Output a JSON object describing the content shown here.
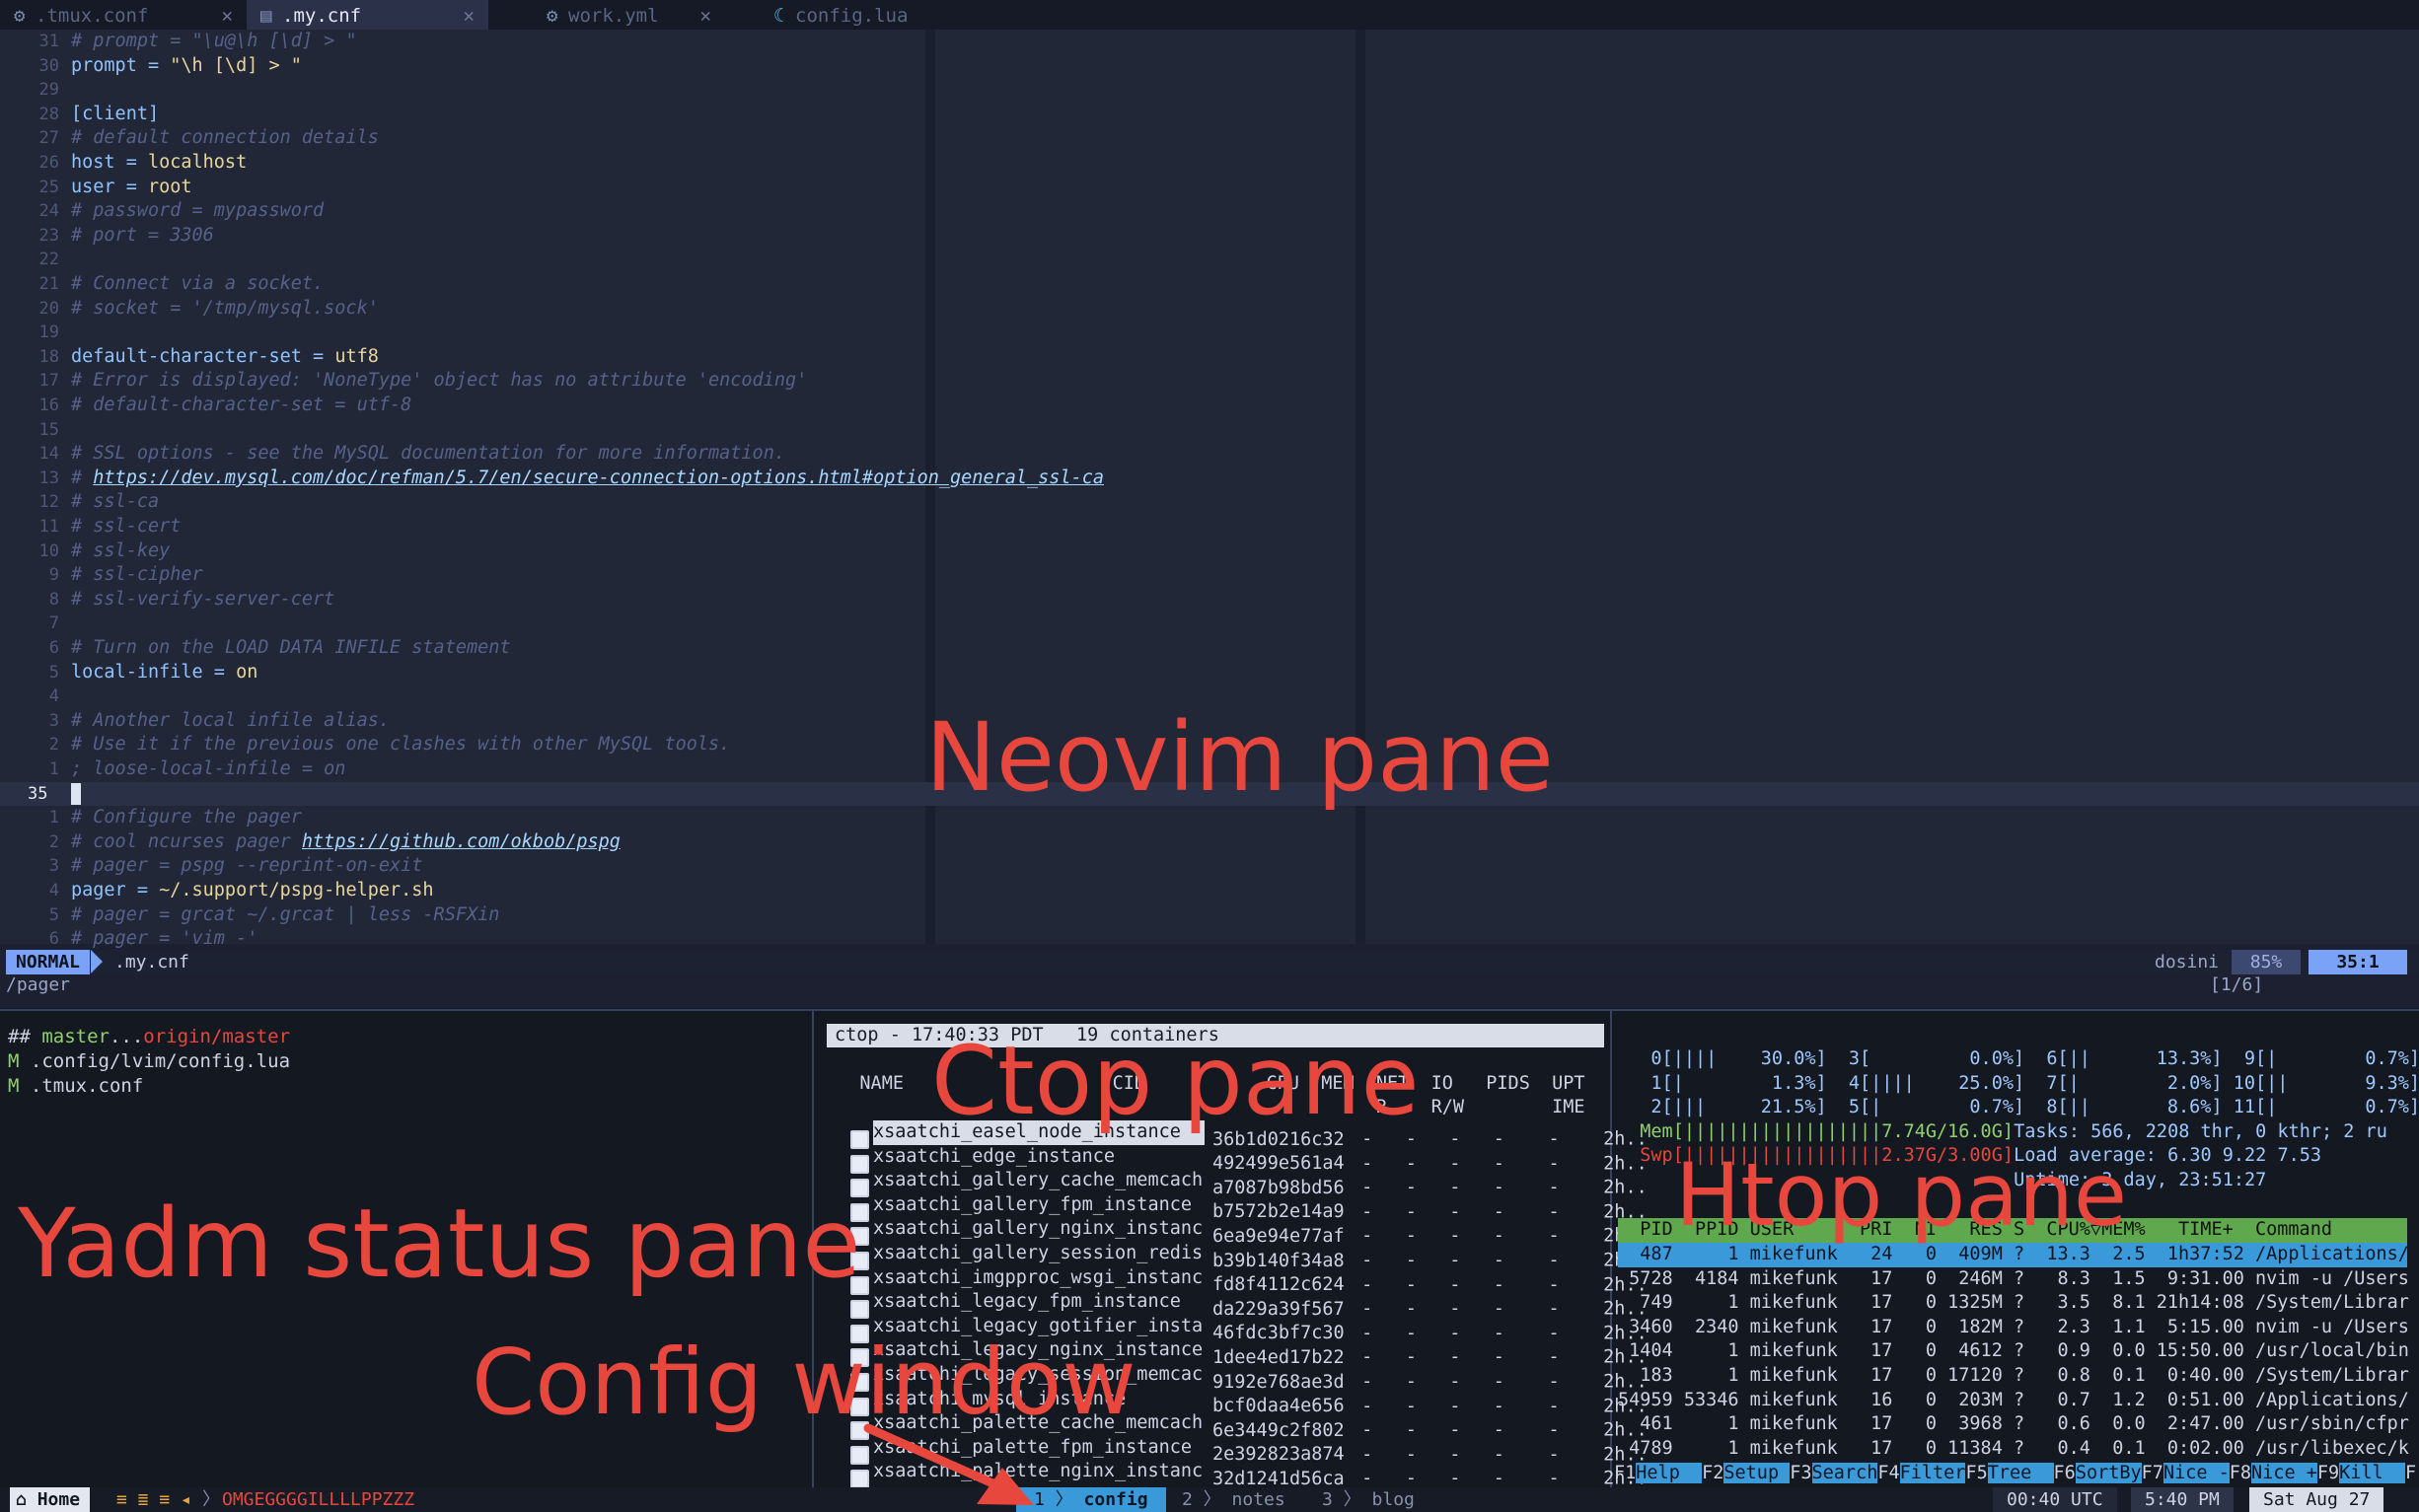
{
  "tabs": [
    {
      "label": ".tmux.conf",
      "icon": "gear"
    },
    {
      "label": ".my.cnf",
      "icon": "file"
    },
    {
      "label": "work.yml",
      "icon": "gear"
    },
    {
      "label": "config.lua",
      "icon": "lua"
    }
  ],
  "editor": {
    "lines": [
      {
        "n": "31",
        "t": "# prompt = \"\\u@\\h [\\d] > \"",
        "k": "cmt"
      },
      {
        "n": "30",
        "t": "prompt = \"\\h [\\d] > \"",
        "k": "kv"
      },
      {
        "n": "29",
        "t": "",
        "k": "plain"
      },
      {
        "n": "28",
        "t": "[client]",
        "k": "sect"
      },
      {
        "n": "27",
        "t": "# default connection details",
        "k": "cmt"
      },
      {
        "n": "26",
        "t": "host = localhost",
        "k": "kv"
      },
      {
        "n": "25",
        "t": "user = root",
        "k": "kv"
      },
      {
        "n": "24",
        "t": "# password = mypassword",
        "k": "cmt"
      },
      {
        "n": "23",
        "t": "# port = 3306",
        "k": "cmt"
      },
      {
        "n": "22",
        "t": "",
        "k": "plain"
      },
      {
        "n": "21",
        "t": "# Connect via a socket.",
        "k": "cmt"
      },
      {
        "n": "20",
        "t": "# socket = '/tmp/mysql.sock'",
        "k": "cmt"
      },
      {
        "n": "19",
        "t": "",
        "k": "plain"
      },
      {
        "n": "18",
        "t": "default-character-set = utf8",
        "k": "kv"
      },
      {
        "n": "17",
        "t": "# Error is displayed: 'NoneType' object has no attribute 'encoding'",
        "k": "cmt"
      },
      {
        "n": "16",
        "t": "# default-character-set = utf-8",
        "k": "cmt"
      },
      {
        "n": "15",
        "t": "",
        "k": "plain"
      },
      {
        "n": "14",
        "t": "# SSL options - see the MySQL documentation for more information.",
        "k": "cmt"
      },
      {
        "n": "13",
        "t": "# ",
        "k": "cmt",
        "url": "https://dev.mysql.com/doc/refman/5.7/en/secure-connection-options.html#option_general_ssl-ca"
      },
      {
        "n": "12",
        "t": "# ssl-ca",
        "k": "cmt"
      },
      {
        "n": "11",
        "t": "# ssl-cert",
        "k": "cmt"
      },
      {
        "n": "10",
        "t": "# ssl-key",
        "k": "cmt"
      },
      {
        "n": "9",
        "t": "# ssl-cipher",
        "k": "cmt"
      },
      {
        "n": "8",
        "t": "# ssl-verify-server-cert",
        "k": "cmt"
      },
      {
        "n": "7",
        "t": "",
        "k": "plain"
      },
      {
        "n": "6",
        "t": "# Turn on the LOAD DATA INFILE statement",
        "k": "cmt"
      },
      {
        "n": "5",
        "t": "local-infile = on",
        "k": "kv"
      },
      {
        "n": "4",
        "t": "",
        "k": "plain"
      },
      {
        "n": "3",
        "t": "# Another local infile alias.",
        "k": "cmt"
      },
      {
        "n": "2",
        "t": "# Use it if the previous one clashes with other MySQL tools.",
        "k": "cmt"
      },
      {
        "n": "1",
        "t": "; loose-local-infile = on",
        "k": "cmt"
      },
      {
        "n": "35",
        "t": "",
        "k": "cursor"
      },
      {
        "n": "1",
        "t": "# Configure the pager",
        "k": "cmt"
      },
      {
        "n": "2",
        "t": "# cool ncurses pager ",
        "k": "cmt",
        "url": "https://github.com/okbob/pspg"
      },
      {
        "n": "3",
        "t": "# pager = pspg --reprint-on-exit",
        "k": "cmt"
      },
      {
        "n": "4",
        "t": "pager = ~/.support/pspg-helper.sh",
        "k": "kv"
      },
      {
        "n": "5",
        "t": "# pager = grcat ~/.grcat | less -RSFXin",
        "k": "cmt"
      },
      {
        "n": "6",
        "t": "# pager = 'vim -'",
        "k": "cmt"
      }
    ]
  },
  "statusline": {
    "mode": "NORMAL",
    "filename": ".my.cnf",
    "filetype": "dosini",
    "percent": "85%",
    "position": "35:1"
  },
  "cmdline": {
    "text": "/pager",
    "count": "[1/6]"
  },
  "yadm": {
    "branch_prefix": "## ",
    "branch": "master",
    "sep": "...",
    "remote": "origin/master",
    "files": [
      {
        "status": "M",
        "path": ".config/lvim/config.lua"
      },
      {
        "status": "M",
        "path": ".tmux.conf"
      }
    ]
  },
  "ctop": {
    "header": "ctop - 17:40:33 PDT   19 containers",
    "cols1": "   NAME                   CID           CPU  MEM  NET  IO   PIDS  UPT",
    "cols2": "                                                  R..  R/W        IME",
    "rows": [
      {
        "name": "xsaatchi_easel_node_instance",
        "cid": "36b1d0216c32",
        "stats": " -   -   -   -    -    2h.."
      },
      {
        "name": "xsaatchi_edge_instance",
        "cid": "492499e561a4",
        "stats": " -   -   -   -    -    2h.."
      },
      {
        "name": "xsaatchi_gallery_cache_memcach",
        "cid": "a7087b98bd56",
        "stats": " -   -   -   -    -    2h.."
      },
      {
        "name": "xsaatchi_gallery_fpm_instance",
        "cid": "b7572b2e14a9",
        "stats": " -   -   -   -    -    2h.."
      },
      {
        "name": "xsaatchi_gallery_nginx_instanc",
        "cid": "6ea9e94e77af",
        "stats": " -   -   -   -    -    2h.."
      },
      {
        "name": "xsaatchi_gallery_session_redis",
        "cid": "b39b140f34a8",
        "stats": " -   -   -   -    -    2h.."
      },
      {
        "name": "xsaatchi_imgpproc_wsgi_instanc",
        "cid": "fd8f4112c624",
        "stats": " -   -   -   -    -    2h.."
      },
      {
        "name": "xsaatchi_legacy_fpm_instance",
        "cid": "da229a39f567",
        "stats": " -   -   -   -    -    2h.."
      },
      {
        "name": "xsaatchi_legacy_gotifier_insta",
        "cid": "46fdc3bf7c30",
        "stats": " -   -   -   -    -    2h.."
      },
      {
        "name": "xsaatchi_legacy_nginx_instance",
        "cid": "1dee4ed17b22",
        "stats": " -   -   -   -    -    2h.."
      },
      {
        "name": "xsaatchi_legacy_session_memcac",
        "cid": "9192e768ae3d",
        "stats": " -   -   -   -    -    2h.."
      },
      {
        "name": "xsaatchi_mysql_instance",
        "cid": "bcf0daa4e656",
        "stats": " -   -   -   -    -    2h.."
      },
      {
        "name": "xsaatchi_palette_cache_memcach",
        "cid": "6e3449c2f802",
        "stats": " -   -   -   -    -    2h.."
      },
      {
        "name": "xsaatchi_palette_fpm_instance",
        "cid": "2e392823a874",
        "stats": " -   -   -   -    -    2h.."
      },
      {
        "name": "xsaatchi_palette_nginx_instanc",
        "cid": "32d1241d56ca",
        "stats": " -   -   -   -    -    2h.."
      }
    ]
  },
  "htop": {
    "cpu_rows": [
      "   0[||||    30.0%]  3[         0.0%]  6[||      13.3%]  9[|        0.7%]",
      "   1[|        1.3%]  4[||||    25.0%]  7[|        2.0%] 10[||       9.3%]",
      "   2[|||     21.5%]  5[|        0.7%]  8[||       8.6%] 11[|        0.7%]"
    ],
    "mem": "  Mem[||||||||||||||||||7.74G/16.0G]",
    "swp": "  Swp[||||||||||||||||||2.37G/3.00G]",
    "tasks": " Tasks: 566, 2208 thr, 0 kthr; 2 ru",
    "load": " Load average: 6.30 9.22 7.53",
    "uptime": " Uptime: 3 day, 23:51:27",
    "header": "  PID  PPID USER      PRI  NI   RES S  CPU%▽MEM%   TIME+  Command",
    "procs": [
      "  487     1 mikefunk   24   0  409M ?  13.3  2.5  1h37:52 /Applications/",
      " 5728  4184 mikefunk   17   0  246M ?   8.3  1.5  9:31.00 nvim -u /Users",
      "  749     1 mikefunk   17   0 1325M ?   3.5  8.1 21h14:08 /System/Librar",
      " 3460  2340 mikefunk   17   0  182M ?   2.3  1.1  5:15.00 nvim -u /Users",
      " 1404     1 mikefunk   17   0  4612 ?   0.9  0.0 15:50.00 /usr/local/bin",
      "  183     1 mikefunk   17   0 17120 ?   0.8  0.1  0:40.00 /System/Librar",
      "54959 53346 mikefunk   16   0  203M ?   0.7  1.2  0:51.00 /Applications/",
      "  461     1 mikefunk   17   0  3968 ?   0.6  0.0  2:47.00 /usr/sbin/cfpr",
      " 4789     1 mikefunk   17   0 11384 ?   0.4  0.1  0:02.00 /usr/libexec/k"
    ],
    "fkeys": [
      {
        "k": "F1",
        "l": "Help  "
      },
      {
        "k": "F2",
        "l": "Setup "
      },
      {
        "k": "F3",
        "l": "Search"
      },
      {
        "k": "F4",
        "l": "Filter"
      },
      {
        "k": "F5",
        "l": "Tree  "
      },
      {
        "k": "F6",
        "l": "SortBy"
      },
      {
        "k": "F7",
        "l": "Nice -"
      },
      {
        "k": "F8",
        "l": "Nice +"
      },
      {
        "k": "F9",
        "l": "Kill  "
      },
      {
        "k": "F",
        "l": ""
      }
    ]
  },
  "tmux": {
    "session": "Home",
    "git_info": "≡ ≣ ≡ ◂",
    "ticker": "OMGEGGGGILLLLPPZZZ",
    "windows": [
      {
        "num": "1",
        "name": "config",
        "active": true
      },
      {
        "num": "2",
        "name": "notes",
        "active": false
      },
      {
        "num": "3",
        "name": "blog",
        "active": false
      }
    ],
    "time_utc": "00:40 UTC",
    "time_local": "5:40 PM",
    "date": "Sat  Aug 27"
  },
  "annotations": {
    "neovim": "Neovim pane",
    "ctop": "Ctop pane",
    "htop": "Htop pane",
    "yadm": "Yadm status pane",
    "config": "Config window"
  },
  "colors": {
    "annotation": "#e8473e",
    "mode": "#7aa2f7",
    "htop_header": "#5fa84e",
    "htop_selected": "#3a9ad9"
  }
}
